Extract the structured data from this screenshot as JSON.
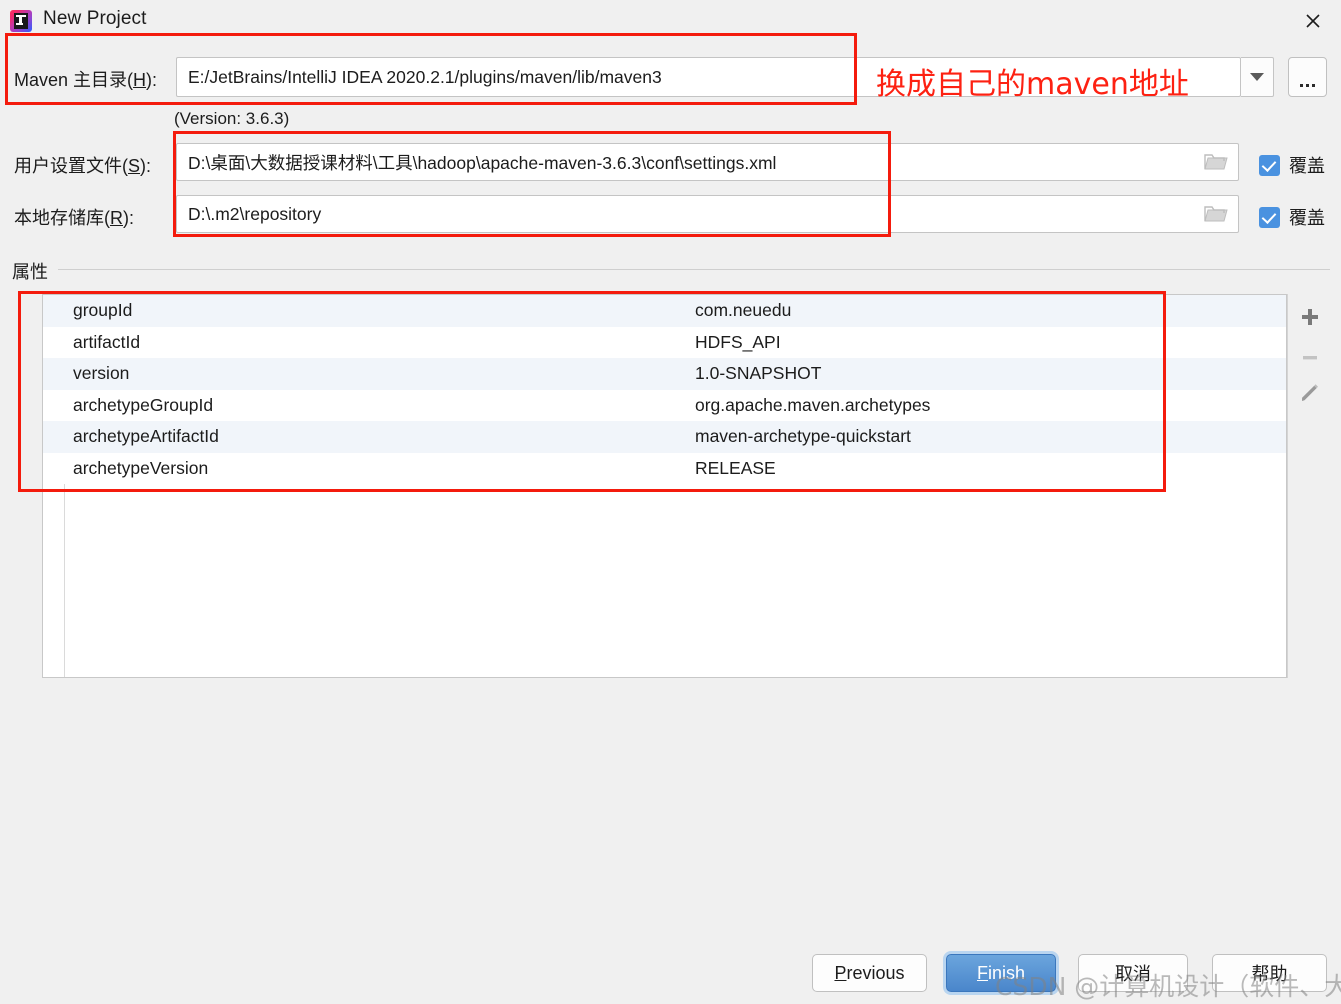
{
  "window": {
    "title": "New Project",
    "app_icon": "intellij-idea-icon",
    "close_icon": "close-icon"
  },
  "fields": {
    "maven_home": {
      "label_prefix": "Maven ",
      "label_cn": "主目录(",
      "label_mnemonic": "H",
      "label_suffix": "):",
      "label_full": "Maven 主目录(H):",
      "value": "E:/JetBrains/IntelliJ IDEA 2020.2.1/plugins/maven/lib/maven3",
      "version_note": "(Version: 3.6.3)",
      "dropdown_icon": "chevron-down-icon",
      "browse_label": "...",
      "browse_icon": "ellipsis-icon"
    },
    "user_settings": {
      "label_cn": "用户设置文件(",
      "label_mnemonic": "S",
      "label_suffix": "):",
      "label_full": "用户设置文件(S):",
      "value": "D:\\桌面\\大数据授课材料\\工具\\hadoop\\apache-maven-3.6.3\\conf\\settings.xml",
      "folder_icon": "folder-icon",
      "override_label": "覆盖",
      "override_checked": true
    },
    "local_repository": {
      "label_cn": "本地存储库(",
      "label_mnemonic": "R",
      "label_suffix": "):",
      "label_full": "本地存储库(R):",
      "value": "D:\\.m2\\repository",
      "folder_icon": "folder-icon",
      "override_label": "覆盖",
      "override_checked": true
    }
  },
  "properties_section": {
    "title": "属性",
    "rows": [
      {
        "key": "groupId",
        "value": "com.neuedu"
      },
      {
        "key": "artifactId",
        "value": "HDFS_API"
      },
      {
        "key": "version",
        "value": "1.0-SNAPSHOT"
      },
      {
        "key": "archetypeGroupId",
        "value": "org.apache.maven.archetypes"
      },
      {
        "key": "archetypeArtifactId",
        "value": "maven-archetype-quickstart"
      },
      {
        "key": "archetypeVersion",
        "value": "RELEASE"
      }
    ],
    "toolbar": {
      "add_icon": "plus-icon",
      "remove_icon": "minus-icon",
      "edit_icon": "pencil-icon"
    }
  },
  "footer": {
    "previous": {
      "label": "Previous",
      "mnemonic": "P",
      "rest": "revious"
    },
    "finish": {
      "label": "Finish",
      "mnemonic": "F",
      "rest": "inish"
    },
    "cancel": {
      "label": "取消"
    },
    "help": {
      "label": "帮助"
    }
  },
  "annotations": {
    "maven_note": "换成自己的maven地址",
    "box_color": "#f41b0d"
  },
  "watermark": {
    "text": "CSDN @计算机设计（软件、大数据）"
  }
}
